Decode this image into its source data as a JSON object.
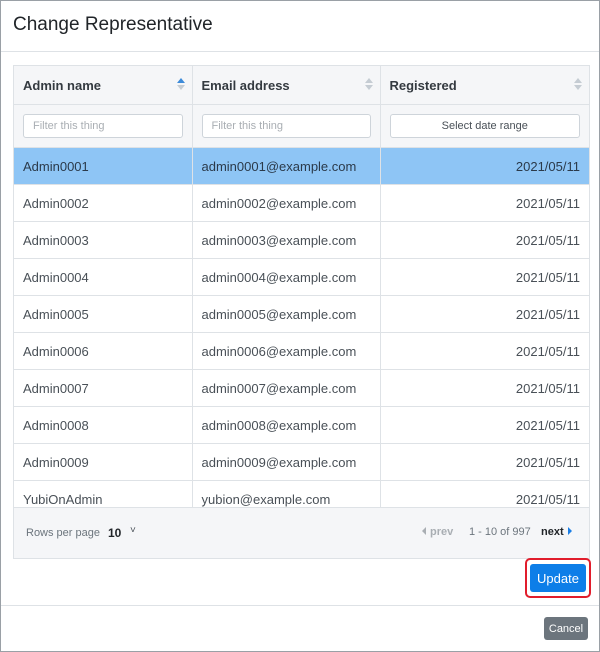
{
  "modal": {
    "title": "Change Representative"
  },
  "table": {
    "columns": [
      {
        "label": "Admin name",
        "sort": "asc",
        "filter_placeholder": "Filter this thing"
      },
      {
        "label": "Email address",
        "sort": "none",
        "filter_placeholder": "Filter this thing"
      },
      {
        "label": "Registered",
        "sort": "none",
        "filter_placeholder": "Select date range"
      }
    ],
    "rows": [
      {
        "name": "Admin0001",
        "email": "admin0001@example.com",
        "registered": "2021/05/11",
        "selected": true
      },
      {
        "name": "Admin0002",
        "email": "admin0002@example.com",
        "registered": "2021/05/11",
        "selected": false
      },
      {
        "name": "Admin0003",
        "email": "admin0003@example.com",
        "registered": "2021/05/11",
        "selected": false
      },
      {
        "name": "Admin0004",
        "email": "admin0004@example.com",
        "registered": "2021/05/11",
        "selected": false
      },
      {
        "name": "Admin0005",
        "email": "admin0005@example.com",
        "registered": "2021/05/11",
        "selected": false
      },
      {
        "name": "Admin0006",
        "email": "admin0006@example.com",
        "registered": "2021/05/11",
        "selected": false
      },
      {
        "name": "Admin0007",
        "email": "admin0007@example.com",
        "registered": "2021/05/11",
        "selected": false
      },
      {
        "name": "Admin0008",
        "email": "admin0008@example.com",
        "registered": "2021/05/11",
        "selected": false
      },
      {
        "name": "Admin0009",
        "email": "admin0009@example.com",
        "registered": "2021/05/11",
        "selected": false
      },
      {
        "name": "YubiOnAdmin",
        "email": "yubion@example.com",
        "registered": "2021/05/11",
        "selected": false
      }
    ],
    "footer": {
      "rows_per_page_label": "Rows per page",
      "rows_per_page_value": "10",
      "prev_label": "prev",
      "range_text": "1 - 10 of 997",
      "next_label": "next"
    }
  },
  "buttons": {
    "update": "Update",
    "cancel": "Cancel"
  },
  "colors": {
    "selected_row": "#8ec5f5",
    "primary": "#0d7ee8",
    "highlight_border": "#e11d2c",
    "secondary": "#6c757d"
  },
  "icons": {
    "sort": "sort-arrows-icon",
    "chevron": "chevron-down-icon",
    "prev": "caret-left-icon",
    "next": "caret-right-icon"
  }
}
